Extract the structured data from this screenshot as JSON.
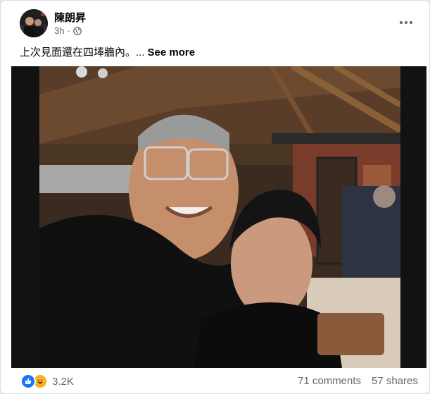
{
  "post": {
    "author": "陳朗昇",
    "timestamp": "3h",
    "separator": "·",
    "privacy_icon": "globe-icon",
    "text": "上次見面還在四埲牆內。...",
    "see_more": "See more",
    "more_icon": "more-dots-icon"
  },
  "footer": {
    "reaction_icons": [
      "like-icon",
      "haha-icon"
    ],
    "reaction_count": "3.2K",
    "comments": "71 comments",
    "shares": "57 shares"
  },
  "colors": {
    "like": "#1877f2",
    "haha": "#f7b125",
    "secondary_text": "#65676b"
  }
}
